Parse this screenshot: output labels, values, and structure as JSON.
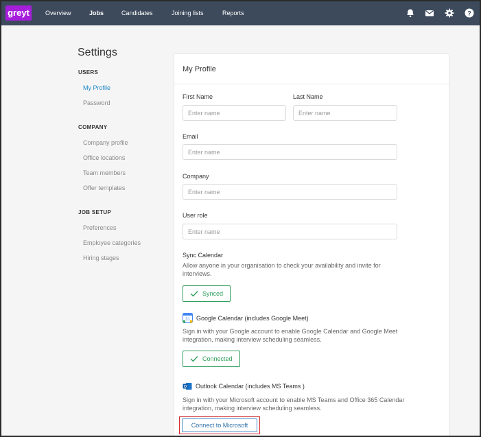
{
  "brand": {
    "logo_text": "greyt"
  },
  "nav": {
    "items": [
      "Overview",
      "Jobs",
      "Candidates",
      "Joining lists",
      "Reports"
    ],
    "active": "Jobs"
  },
  "topbar_icons": [
    "bell-icon",
    "mail-icon",
    "gear-icon",
    "help-icon"
  ],
  "sidebar": {
    "title": "Settings",
    "sections": [
      {
        "heading": "USERS",
        "items": [
          "My Profile",
          "Password"
        ]
      },
      {
        "heading": "COMPANY",
        "items": [
          "Company profile",
          "Office locations",
          "Team members",
          "Offer templates"
        ]
      },
      {
        "heading": "JOB SETUP",
        "items": [
          "Preferences",
          "Employee categories",
          "Hiring stages"
        ]
      }
    ],
    "active_item": "My Profile"
  },
  "profile": {
    "title": "My Profile",
    "first_name": {
      "label": "First Name",
      "placeholder": "Enter name",
      "value": ""
    },
    "last_name": {
      "label": "Last Name",
      "placeholder": "Enter name",
      "value": ""
    },
    "email": {
      "label": "Email",
      "placeholder": "Enter name",
      "value": ""
    },
    "company": {
      "label": "Company",
      "placeholder": "Enter name",
      "value": ""
    },
    "user_role": {
      "label": "User role",
      "placeholder": "Enter name",
      "value": ""
    },
    "sync": {
      "title": "Sync Calendar",
      "description": "Allow anyone in your organisation to check your availability and invite for interviews.",
      "button": "Synced"
    },
    "google": {
      "title": "Google Calendar (includes Google Meet)",
      "description": "Sign in with your Google account to enable Google Calendar and Google Meet integration, making interview scheduling seamless.",
      "button": "Connected",
      "icon_text": "31"
    },
    "outlook": {
      "title": "Outlook Calendar (includes MS Teams )",
      "description": "Sign in with your Microsoft account to enable MS Teams and Office 365 Calendar integration, making interview scheduling seamless.",
      "button": "Connect to Microsoft",
      "icon_text": "O"
    }
  },
  "colors": {
    "topbar": "#3d4a5c",
    "brand": "#a61edb",
    "active_link": "#1e88c9",
    "success": "#2e9e5c",
    "highlight": "#d42a2a"
  }
}
